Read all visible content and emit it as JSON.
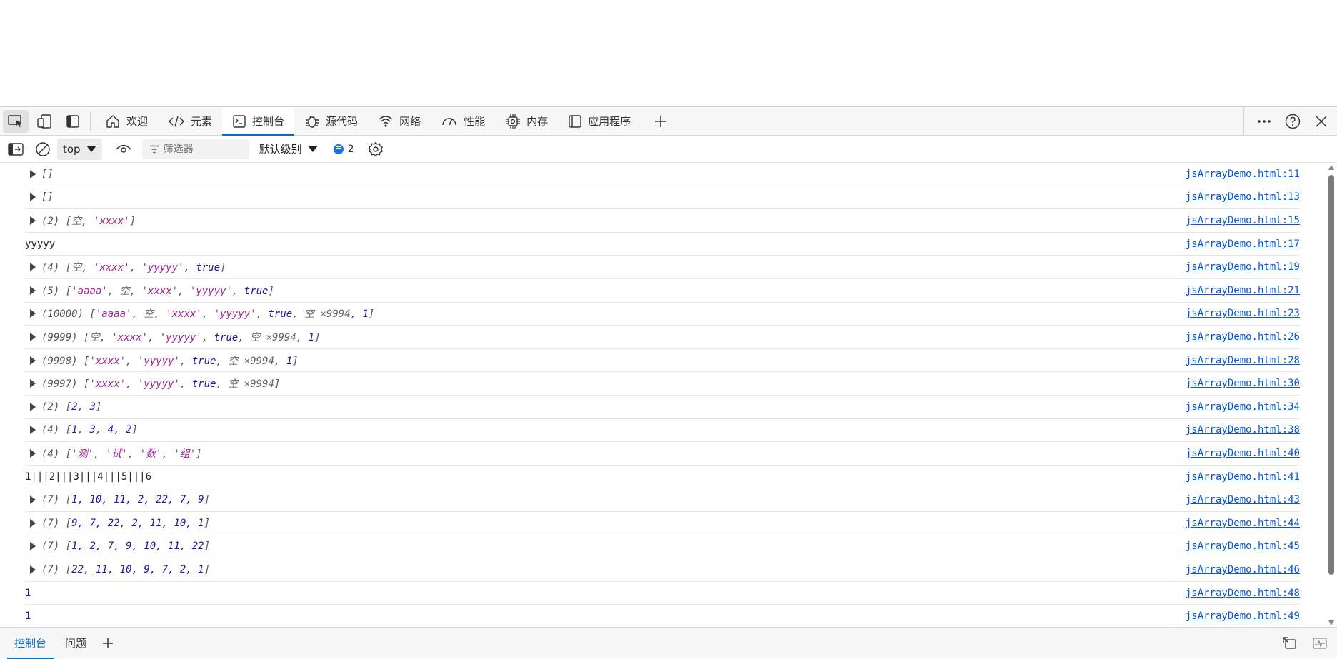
{
  "toolbar": {
    "tabs": [
      {
        "label": "欢迎",
        "icon": "home-icon"
      },
      {
        "label": "元素",
        "icon": "code-icon"
      },
      {
        "label": "控制台",
        "icon": "console-icon",
        "selected": true
      },
      {
        "label": "源代码",
        "icon": "bug-icon"
      },
      {
        "label": "网络",
        "icon": "wifi-icon"
      },
      {
        "label": "性能",
        "icon": "gauge-icon"
      },
      {
        "label": "内存",
        "icon": "chip-icon"
      },
      {
        "label": "应用程序",
        "icon": "app-window-icon"
      }
    ]
  },
  "console_toolbar": {
    "context": "top",
    "filter_placeholder": "筛选器",
    "level": "默认级别",
    "message_count": "2"
  },
  "logs": [
    {
      "expandable": true,
      "kind": "obj",
      "segments": [
        {
          "t": "[]",
          "c": "obj"
        }
      ],
      "source": "jsArrayDemo.html:11"
    },
    {
      "expandable": true,
      "kind": "obj",
      "segments": [
        {
          "t": "[]",
          "c": "obj"
        }
      ],
      "source": "jsArrayDemo.html:13"
    },
    {
      "expandable": true,
      "kind": "obj",
      "segments": [
        {
          "t": "(2) [",
          "c": "obj"
        },
        {
          "t": "空",
          "c": "c-empty"
        },
        {
          "t": ", ",
          "c": "obj"
        },
        {
          "t": "'xxxx'",
          "c": "c-str"
        },
        {
          "t": "]",
          "c": "obj"
        }
      ],
      "source": "jsArrayDemo.html:15"
    },
    {
      "expandable": false,
      "kind": "plain",
      "segments": [
        {
          "t": "yyyyy",
          "c": "plain"
        }
      ],
      "source": "jsArrayDemo.html:17"
    },
    {
      "expandable": true,
      "kind": "obj",
      "segments": [
        {
          "t": "(4) [",
          "c": "obj"
        },
        {
          "t": "空",
          "c": "c-empty"
        },
        {
          "t": ", ",
          "c": "obj"
        },
        {
          "t": "'xxxx'",
          "c": "c-str"
        },
        {
          "t": ", ",
          "c": "obj"
        },
        {
          "t": "'yyyyy'",
          "c": "c-str"
        },
        {
          "t": ", ",
          "c": "obj"
        },
        {
          "t": "true",
          "c": "c-kw"
        },
        {
          "t": "]",
          "c": "obj"
        }
      ],
      "source": "jsArrayDemo.html:19"
    },
    {
      "expandable": true,
      "kind": "obj",
      "segments": [
        {
          "t": "(5) [",
          "c": "obj"
        },
        {
          "t": "'aaaa'",
          "c": "c-str"
        },
        {
          "t": ", ",
          "c": "obj"
        },
        {
          "t": "空",
          "c": "c-empty"
        },
        {
          "t": ", ",
          "c": "obj"
        },
        {
          "t": "'xxxx'",
          "c": "c-str"
        },
        {
          "t": ", ",
          "c": "obj"
        },
        {
          "t": "'yyyyy'",
          "c": "c-str"
        },
        {
          "t": ", ",
          "c": "obj"
        },
        {
          "t": "true",
          "c": "c-kw"
        },
        {
          "t": "]",
          "c": "obj"
        }
      ],
      "source": "jsArrayDemo.html:21"
    },
    {
      "expandable": true,
      "kind": "obj",
      "segments": [
        {
          "t": "(10000) [",
          "c": "obj"
        },
        {
          "t": "'aaaa'",
          "c": "c-str"
        },
        {
          "t": ", ",
          "c": "obj"
        },
        {
          "t": "空",
          "c": "c-empty"
        },
        {
          "t": ", ",
          "c": "obj"
        },
        {
          "t": "'xxxx'",
          "c": "c-str"
        },
        {
          "t": ", ",
          "c": "obj"
        },
        {
          "t": "'yyyyy'",
          "c": "c-str"
        },
        {
          "t": ", ",
          "c": "obj"
        },
        {
          "t": "true",
          "c": "c-kw"
        },
        {
          "t": ", ",
          "c": "obj"
        },
        {
          "t": "空 ×9994",
          "c": "c-empty"
        },
        {
          "t": ", ",
          "c": "obj"
        },
        {
          "t": "1",
          "c": "c-num"
        },
        {
          "t": "]",
          "c": "obj"
        }
      ],
      "source": "jsArrayDemo.html:23"
    },
    {
      "expandable": true,
      "kind": "obj",
      "segments": [
        {
          "t": "(9999) [",
          "c": "obj"
        },
        {
          "t": "空",
          "c": "c-empty"
        },
        {
          "t": ", ",
          "c": "obj"
        },
        {
          "t": "'xxxx'",
          "c": "c-str"
        },
        {
          "t": ", ",
          "c": "obj"
        },
        {
          "t": "'yyyyy'",
          "c": "c-str"
        },
        {
          "t": ", ",
          "c": "obj"
        },
        {
          "t": "true",
          "c": "c-kw"
        },
        {
          "t": ", ",
          "c": "obj"
        },
        {
          "t": "空 ×9994",
          "c": "c-empty"
        },
        {
          "t": ", ",
          "c": "obj"
        },
        {
          "t": "1",
          "c": "c-num"
        },
        {
          "t": "]",
          "c": "obj"
        }
      ],
      "source": "jsArrayDemo.html:26"
    },
    {
      "expandable": true,
      "kind": "obj",
      "segments": [
        {
          "t": "(9998) [",
          "c": "obj"
        },
        {
          "t": "'xxxx'",
          "c": "c-str"
        },
        {
          "t": ", ",
          "c": "obj"
        },
        {
          "t": "'yyyyy'",
          "c": "c-str"
        },
        {
          "t": ", ",
          "c": "obj"
        },
        {
          "t": "true",
          "c": "c-kw"
        },
        {
          "t": ", ",
          "c": "obj"
        },
        {
          "t": "空 ×9994",
          "c": "c-empty"
        },
        {
          "t": ", ",
          "c": "obj"
        },
        {
          "t": "1",
          "c": "c-num"
        },
        {
          "t": "]",
          "c": "obj"
        }
      ],
      "source": "jsArrayDemo.html:28"
    },
    {
      "expandable": true,
      "kind": "obj",
      "segments": [
        {
          "t": "(9997) [",
          "c": "obj"
        },
        {
          "t": "'xxxx'",
          "c": "c-str"
        },
        {
          "t": ", ",
          "c": "obj"
        },
        {
          "t": "'yyyyy'",
          "c": "c-str"
        },
        {
          "t": ", ",
          "c": "obj"
        },
        {
          "t": "true",
          "c": "c-kw"
        },
        {
          "t": ", ",
          "c": "obj"
        },
        {
          "t": "空 ×9994",
          "c": "c-empty"
        },
        {
          "t": "]",
          "c": "obj"
        }
      ],
      "source": "jsArrayDemo.html:30"
    },
    {
      "expandable": true,
      "kind": "obj",
      "segments": [
        {
          "t": "(2) [",
          "c": "obj"
        },
        {
          "t": "2",
          "c": "c-num"
        },
        {
          "t": ", ",
          "c": "obj"
        },
        {
          "t": "3",
          "c": "c-num"
        },
        {
          "t": "]",
          "c": "obj"
        }
      ],
      "source": "jsArrayDemo.html:34"
    },
    {
      "expandable": true,
      "kind": "obj",
      "segments": [
        {
          "t": "(4) [",
          "c": "obj"
        },
        {
          "t": "1",
          "c": "c-num"
        },
        {
          "t": ", ",
          "c": "obj"
        },
        {
          "t": "3",
          "c": "c-num"
        },
        {
          "t": ", ",
          "c": "obj"
        },
        {
          "t": "4",
          "c": "c-num"
        },
        {
          "t": ", ",
          "c": "obj"
        },
        {
          "t": "2",
          "c": "c-num"
        },
        {
          "t": "]",
          "c": "obj"
        }
      ],
      "source": "jsArrayDemo.html:38"
    },
    {
      "expandable": true,
      "kind": "obj",
      "segments": [
        {
          "t": "(4) [",
          "c": "obj"
        },
        {
          "t": "'测'",
          "c": "c-str"
        },
        {
          "t": ", ",
          "c": "obj"
        },
        {
          "t": "'试'",
          "c": "c-str"
        },
        {
          "t": ", ",
          "c": "obj"
        },
        {
          "t": "'数'",
          "c": "c-str"
        },
        {
          "t": ", ",
          "c": "obj"
        },
        {
          "t": "'组'",
          "c": "c-str"
        },
        {
          "t": "]",
          "c": "obj"
        }
      ],
      "source": "jsArrayDemo.html:40"
    },
    {
      "expandable": false,
      "kind": "plain",
      "segments": [
        {
          "t": "1|||2|||3|||4|||5|||6",
          "c": "plain"
        }
      ],
      "source": "jsArrayDemo.html:41"
    },
    {
      "expandable": true,
      "kind": "obj",
      "segments": [
        {
          "t": "(7) [",
          "c": "obj"
        },
        {
          "t": "1, 10, 11, 2, 22, 7, 9",
          "c": "c-num"
        },
        {
          "t": "]",
          "c": "obj"
        }
      ],
      "source": "jsArrayDemo.html:43"
    },
    {
      "expandable": true,
      "kind": "obj",
      "segments": [
        {
          "t": "(7) [",
          "c": "obj"
        },
        {
          "t": "9, 7, 22, 2, 11, 10, 1",
          "c": "c-num"
        },
        {
          "t": "]",
          "c": "obj"
        }
      ],
      "source": "jsArrayDemo.html:44"
    },
    {
      "expandable": true,
      "kind": "obj",
      "segments": [
        {
          "t": "(7) [",
          "c": "obj"
        },
        {
          "t": "1, 2, 7, 9, 10, 11, 22",
          "c": "c-num"
        },
        {
          "t": "]",
          "c": "obj"
        }
      ],
      "source": "jsArrayDemo.html:45"
    },
    {
      "expandable": true,
      "kind": "obj",
      "segments": [
        {
          "t": "(7) [",
          "c": "obj"
        },
        {
          "t": "22, 11, 10, 9, 7, 2, 1",
          "c": "c-num"
        },
        {
          "t": "]",
          "c": "obj"
        }
      ],
      "source": "jsArrayDemo.html:46"
    },
    {
      "expandable": false,
      "kind": "num",
      "segments": [
        {
          "t": "1",
          "c": "num-out"
        }
      ],
      "source": "jsArrayDemo.html:48"
    },
    {
      "expandable": false,
      "kind": "num",
      "segments": [
        {
          "t": "1",
          "c": "num-out"
        }
      ],
      "source": "jsArrayDemo.html:49"
    }
  ],
  "drawer": {
    "tabs": [
      {
        "label": "控制台",
        "selected": true
      },
      {
        "label": "问题"
      }
    ]
  },
  "colors": {
    "accent": "#0f6cbd",
    "string": "#a0259a",
    "number": "#1a1aa6",
    "link": "#0b57d0"
  }
}
